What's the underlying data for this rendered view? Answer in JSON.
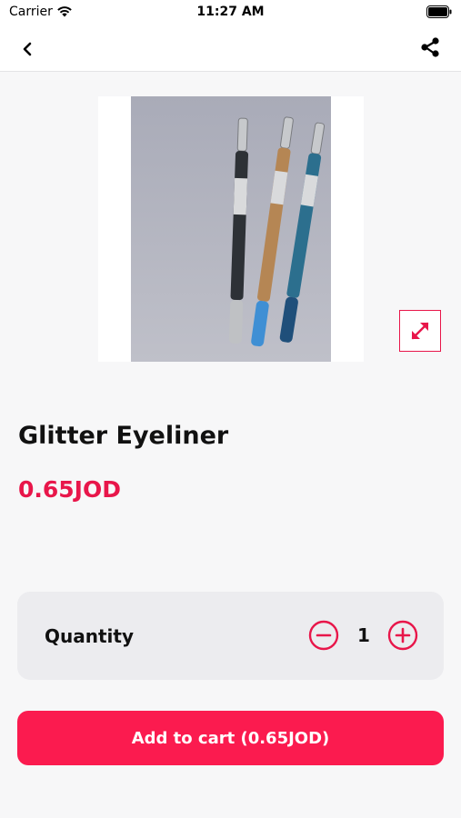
{
  "status_bar": {
    "carrier": "Carrier",
    "time": "11:27 AM",
    "icons": [
      "wifi-icon",
      "battery-icon"
    ]
  },
  "nav": {
    "icons": [
      "chevron-left-icon",
      "share-icon"
    ]
  },
  "product": {
    "title": "Glitter Eyeliner",
    "price": "0.65JOD",
    "image_icon": "product-photo",
    "expand_icon": "expand-icon"
  },
  "quantity": {
    "label": "Quantity",
    "value": "1",
    "icons": [
      "minus-circle-icon",
      "plus-circle-icon"
    ]
  },
  "cart": {
    "button_label": "Add to cart (0.65JOD)"
  },
  "colors": {
    "accent": "#e8164a",
    "button": "#fb1b4f",
    "background": "#f7f7f8",
    "card": "#ececef"
  }
}
